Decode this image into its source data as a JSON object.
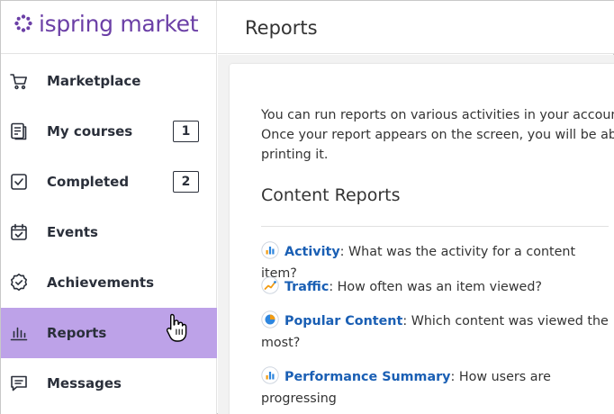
{
  "app": {
    "logo_text": "ispring market"
  },
  "sidebar": {
    "items": [
      {
        "label": "Marketplace",
        "icon": "cart-icon"
      },
      {
        "label": "My courses",
        "icon": "document-icon",
        "badge": "1"
      },
      {
        "label": "Completed",
        "icon": "checkbox-icon",
        "badge": "2"
      },
      {
        "label": "Events",
        "icon": "calendar-check-icon"
      },
      {
        "label": "Achievements",
        "icon": "medal-icon"
      },
      {
        "label": "Reports",
        "icon": "bar-chart-icon",
        "active": true
      },
      {
        "label": "Messages",
        "icon": "message-icon"
      }
    ]
  },
  "header": {
    "title": "Reports"
  },
  "main": {
    "intro_lines": [
      "You can run reports on various activities in your account",
      "Once your report appears on the screen, you will be able",
      "printing it."
    ],
    "section_title": "Content Reports",
    "reports": [
      {
        "name": "Activity",
        "description": ": What was the activity for a content item?",
        "icon": "bar-chart-icon"
      },
      {
        "name": "Traffic",
        "description": ": How often was an item viewed?",
        "icon": "line-chart-icon"
      },
      {
        "name": "Popular Content",
        "description": ": Which content was viewed the most?",
        "icon": "pie-chart-icon"
      },
      {
        "name": "Performance Summary",
        "description": ": How users are progressing",
        "icon": "bar-chart-icon"
      }
    ]
  },
  "colors": {
    "brand": "#6b3fa6",
    "active_nav_bg": "#bda2e8",
    "link": "#1a5fb4"
  }
}
